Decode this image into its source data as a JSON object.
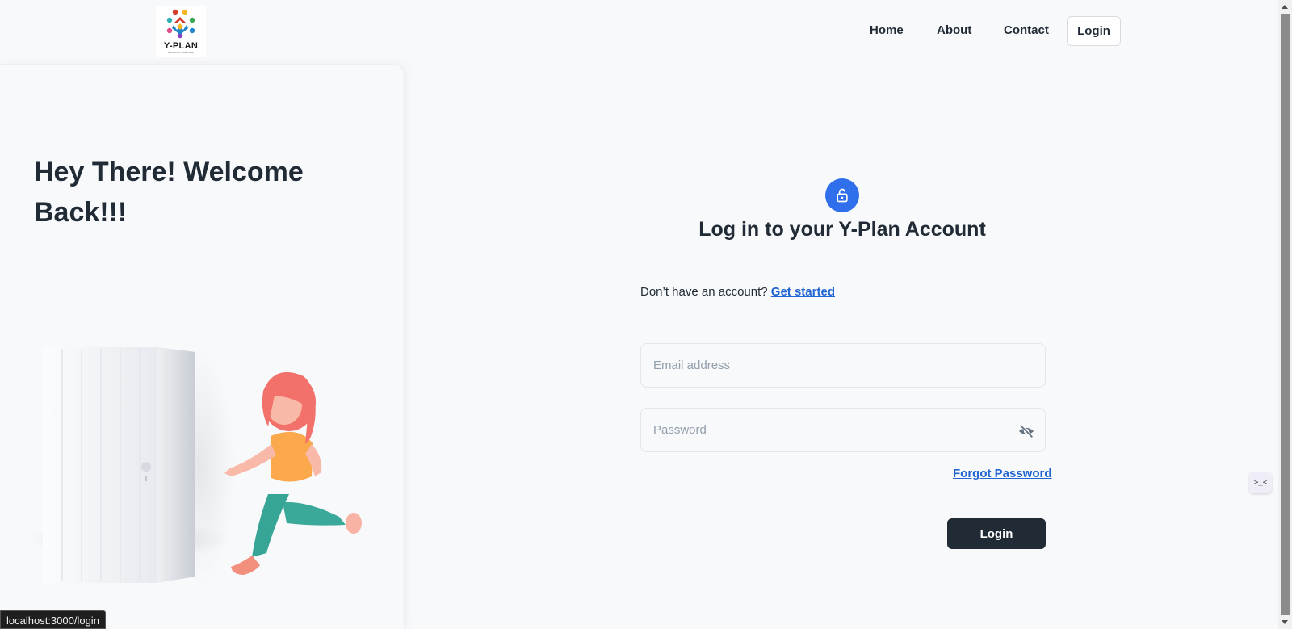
{
  "header": {
    "logo_text": "Y-PLAN",
    "logo_tagline": "GROWING TOGETHER",
    "nav": [
      {
        "label": "Home"
      },
      {
        "label": "About"
      },
      {
        "label": "Contact"
      }
    ],
    "login_label": "Login"
  },
  "left_panel": {
    "welcome": "Hey There! Welcome Back!!!"
  },
  "form": {
    "title": "Log in to your Y-Plan Account",
    "signup_prompt": "Don’t have an account?",
    "signup_link": "Get started",
    "email_placeholder": "Email address",
    "password_placeholder": "Password",
    "forgot_label": "Forgot Password",
    "submit_label": "Login"
  },
  "side_widget": {
    "label": ">_<"
  },
  "status_bar": {
    "url": "localhost:3000/login"
  },
  "colors": {
    "accent": "#2f6fec",
    "link": "#2065d1",
    "button": "#212b36",
    "background": "#f8f9fb"
  },
  "icons": [
    "lock-open-icon",
    "eye-off-icon"
  ]
}
